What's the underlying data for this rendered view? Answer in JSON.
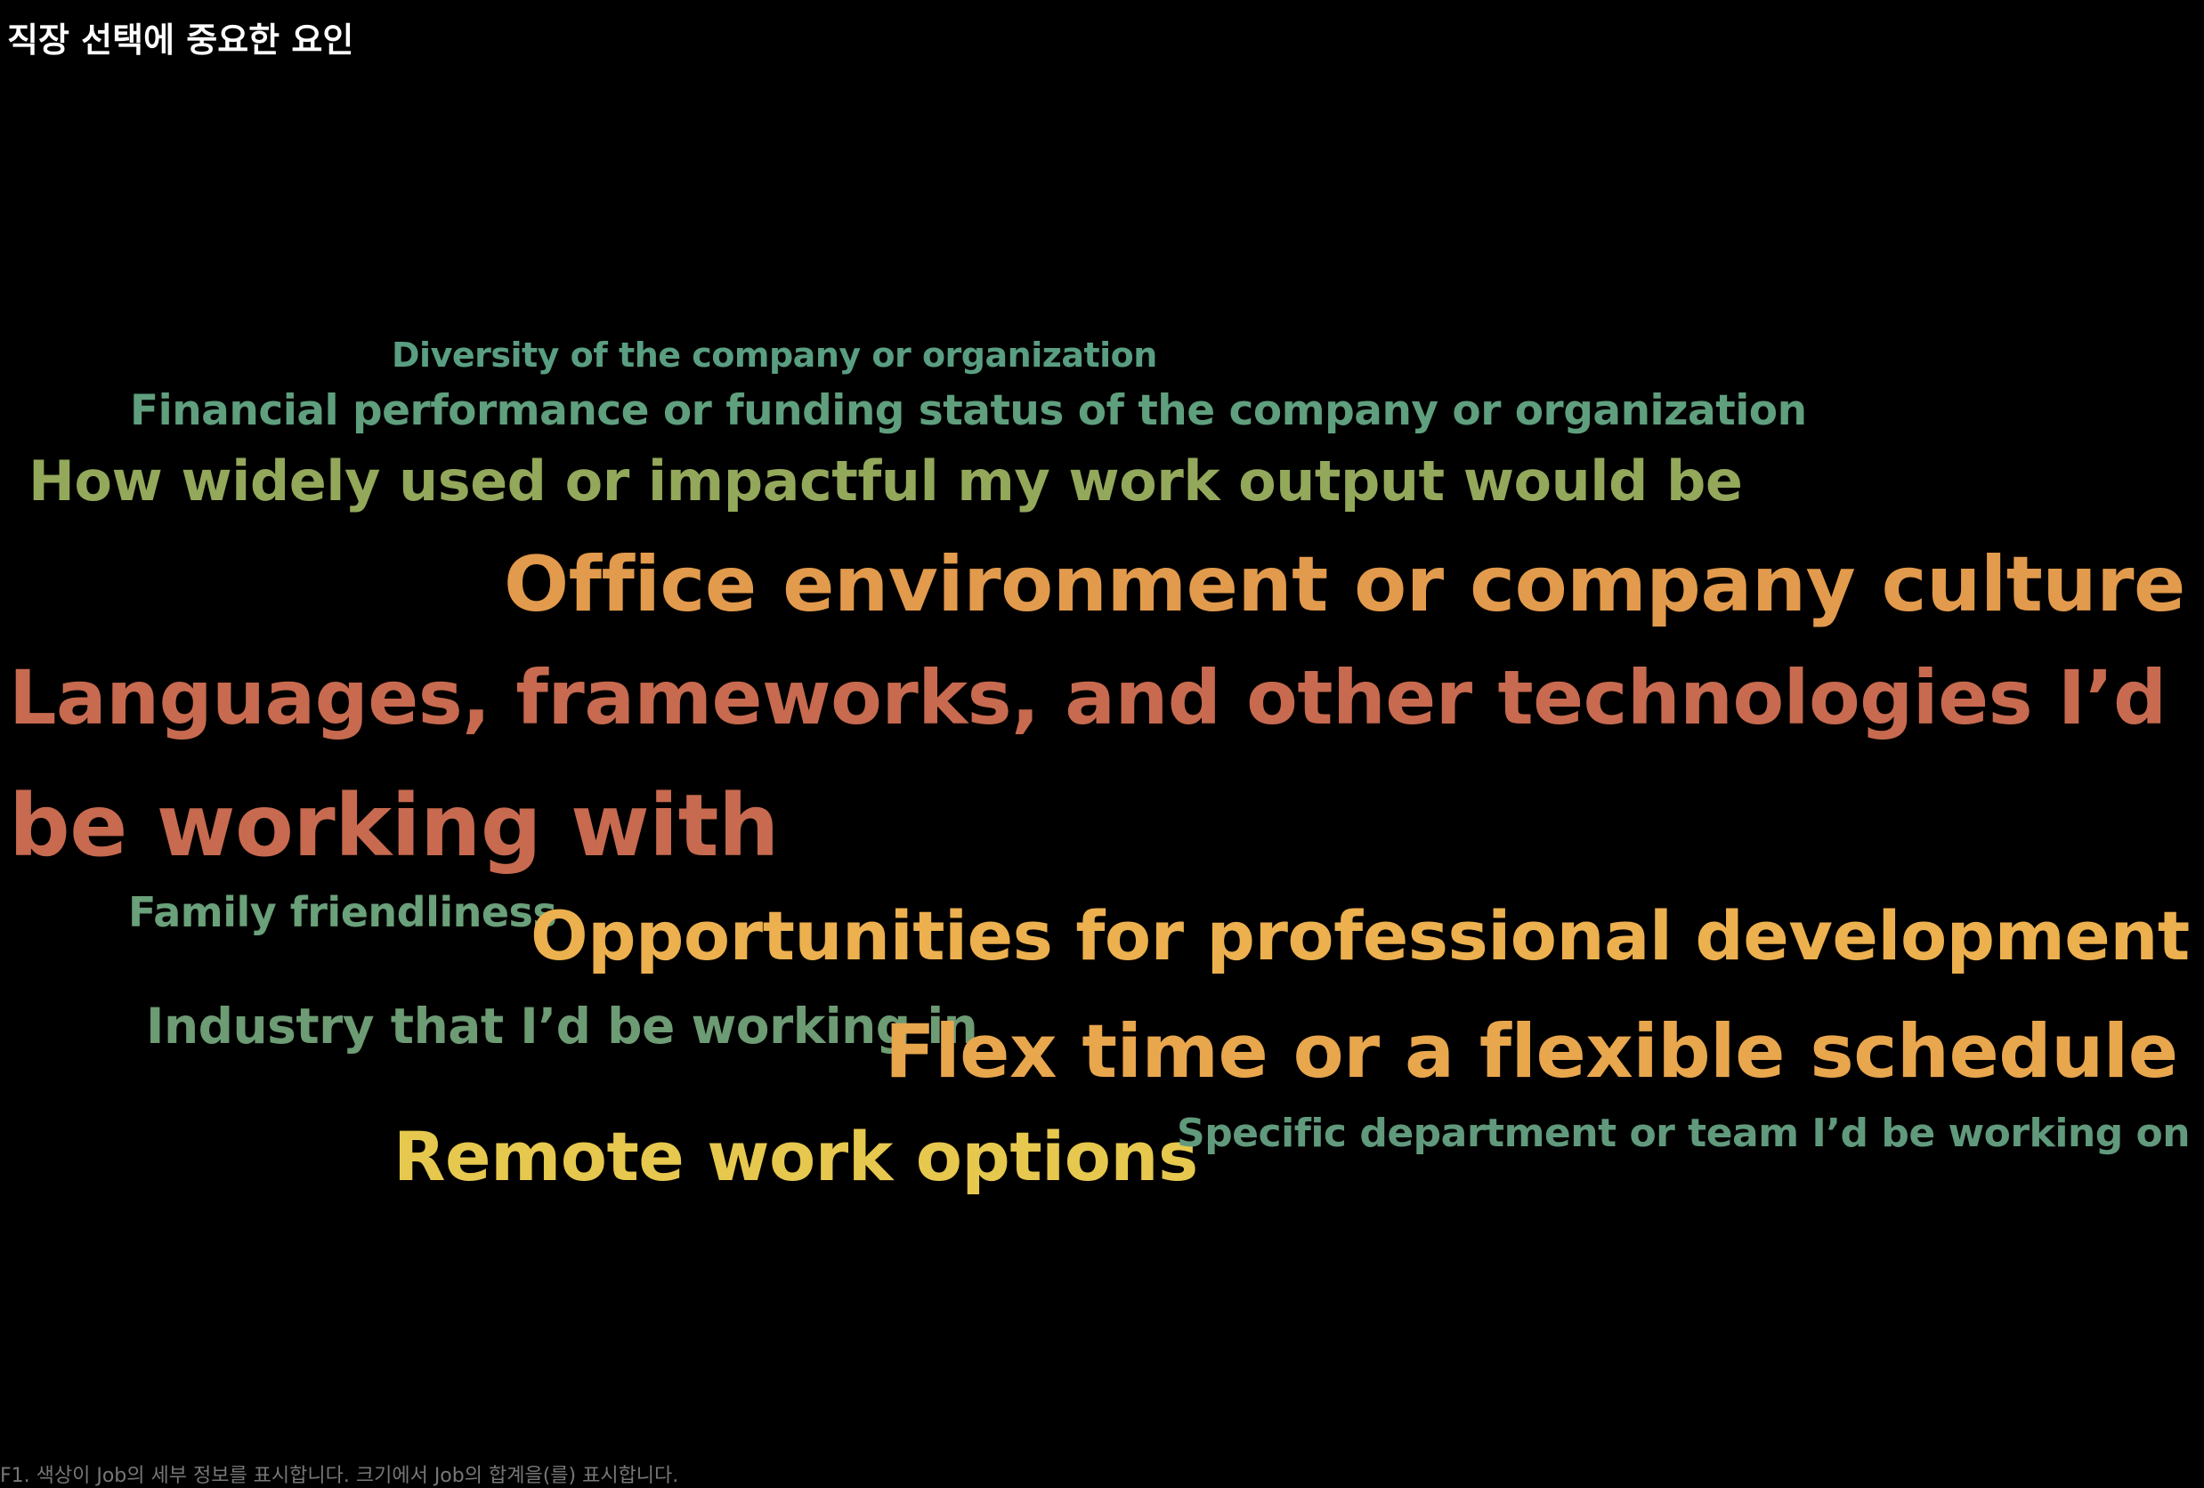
{
  "title": "직장 선택에 중요한 요인",
  "footer": "F1. 색상이 Job의 세부 정보를 표시합니다. 크기에서 Job의 합계을(를) 표시합니다.",
  "chart_data": {
    "type": "word_cloud",
    "title": "직장 선택에 중요한 요인",
    "color_encodes": "Job",
    "size_encodes": "SUM(Job)",
    "words": [
      {
        "text": "Diversity of the company or organization",
        "color": "#5a9e82"
      },
      {
        "text": "Financial performance or funding status of the company or organization",
        "color": "#5f9f7e"
      },
      {
        "text": "How widely used or impactful my work output would be",
        "color": "#93a85a"
      },
      {
        "text": "Office environment or company culture",
        "color": "#e29a4c"
      },
      {
        "text": "Languages, frameworks, and other technologies I’d",
        "color": "#c76a4f"
      },
      {
        "text": "be working with",
        "color": "#c76a4f"
      },
      {
        "text": "Family friendliness",
        "color": "#6aa07a"
      },
      {
        "text": "Opportunities for professional development",
        "color": "#ecb04e"
      },
      {
        "text": "Industry that I’d be working in",
        "color": "#6d9b74"
      },
      {
        "text": "Flex time or a flexible schedule",
        "color": "#e8a64d"
      },
      {
        "text": "Remote work options",
        "color": "#e6c84e"
      },
      {
        "text": "Specific department or team I’d be working on",
        "color": "#61997c"
      }
    ]
  }
}
